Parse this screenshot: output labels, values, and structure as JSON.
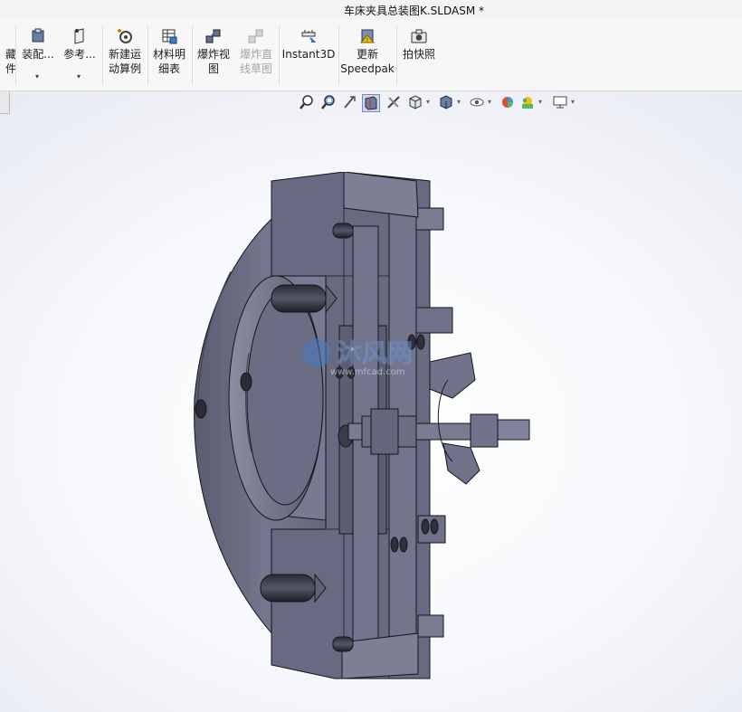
{
  "window": {
    "title": "车床夹具总装图K.SLDASM *"
  },
  "ribbon": {
    "buttons": [
      {
        "id": "hide",
        "label": "藏\n件",
        "icon": "hide-components-icon",
        "dropdown": false,
        "enabled": true
      },
      {
        "id": "assembly",
        "label": "装配...",
        "icon": "assembly-features-icon",
        "dropdown": true,
        "enabled": true
      },
      {
        "id": "reference",
        "label": "参考...",
        "icon": "reference-geometry-icon",
        "dropdown": true,
        "enabled": true
      },
      {
        "id": "new-motion",
        "label": "新建运\n动算例",
        "icon": "new-motion-study-icon",
        "dropdown": false,
        "enabled": true
      },
      {
        "id": "bom",
        "label": "材料明\n细表",
        "icon": "bill-of-materials-icon",
        "dropdown": false,
        "enabled": true
      },
      {
        "id": "explode",
        "label": "爆炸视\n图",
        "icon": "exploded-view-icon",
        "dropdown": false,
        "enabled": true
      },
      {
        "id": "explode-line",
        "label": "爆炸直\n线草图",
        "icon": "explode-line-sketch-icon",
        "dropdown": false,
        "enabled": false
      },
      {
        "id": "instant3d",
        "label": "Instant3D",
        "icon": "instant3d-icon",
        "dropdown": false,
        "enabled": true
      },
      {
        "id": "speedpak",
        "label": "更新\nSpeedpak",
        "icon": "update-speedpak-icon",
        "dropdown": false,
        "enabled": true
      },
      {
        "id": "snapshot",
        "label": "拍快照",
        "icon": "snapshot-camera-icon",
        "dropdown": false,
        "enabled": true
      }
    ]
  },
  "hud_toolbar": {
    "icons": [
      "zoom-to-fit-icon",
      "zoom-to-area-icon",
      "previous-view-icon",
      "section-view-icon",
      "dynamic-annotation-icon",
      "view-orientation-icon",
      "display-style-icon",
      "hide-show-items-icon",
      "edit-appearance-icon",
      "apply-scene-icon",
      "view-settings-icon"
    ]
  },
  "viewport": {
    "watermark_text": "沐风网",
    "watermark_url": "www.mfcad.com",
    "colors": {
      "part_fill": "#6e7086",
      "part_dark": "#4f5166",
      "part_light": "#8a8ca0",
      "edge": "#15161d"
    }
  }
}
